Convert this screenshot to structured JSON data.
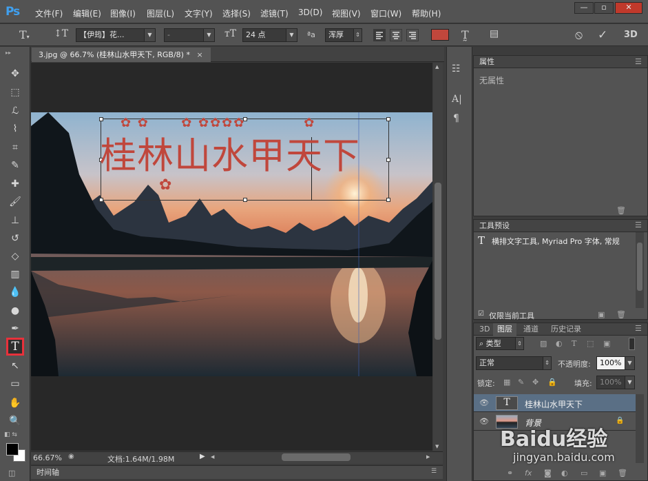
{
  "app": {
    "logo": "Ps"
  },
  "menu": [
    "文件(F)",
    "编辑(E)",
    "图像(I)",
    "图层(L)",
    "文字(Y)",
    "选择(S)",
    "滤镜(T)",
    "3D(D)",
    "视图(V)",
    "窗口(W)",
    "帮助(H)"
  ],
  "window_controls": {
    "minimize": "—",
    "restore": "▫",
    "close": "✕"
  },
  "options": {
    "font_family": "【伊筠】花...",
    "font_style": "-",
    "font_size": "24 点",
    "aa_label": "ªa",
    "anti_alias": "浑厚",
    "text_color": "#c0473c",
    "cancel_icon": "⦸",
    "commit_icon": "✓",
    "threed_label": "3D"
  },
  "document": {
    "tab_title": "3.jpg @ 66.7% (桂林山水甲天下, RGB/8) *",
    "canvas_text": "桂林山水甲天下",
    "text_color": "#c0473c",
    "zoom": "66.67%",
    "doc_info": "文档:1.64M/1.98M"
  },
  "timeline": {
    "label": "时间轴"
  },
  "properties": {
    "title": "属性",
    "empty_text": "无属性"
  },
  "tool_presets": {
    "title": "工具预设",
    "item": "横排文字工具, Myriad Pro 字体, 常规",
    "current_tool_only": "仅限当前工具"
  },
  "layers_panel": {
    "tabs": [
      "3D",
      "图层",
      "通道",
      "历史记录"
    ],
    "active_tab": "图层",
    "filter_label": "类型",
    "blend_mode": "正常",
    "opacity_label": "不透明度:",
    "opacity": "100%",
    "lock_label": "锁定:",
    "fill_label": "填充:",
    "fill": "100%",
    "layers": [
      {
        "name": "桂林山水甲天下",
        "type": "text",
        "selected": true
      },
      {
        "name": "背景",
        "type": "image",
        "locked": true
      }
    ]
  },
  "watermark": {
    "brand": "Baidu经验",
    "url": "jingyan.baidu.com"
  }
}
